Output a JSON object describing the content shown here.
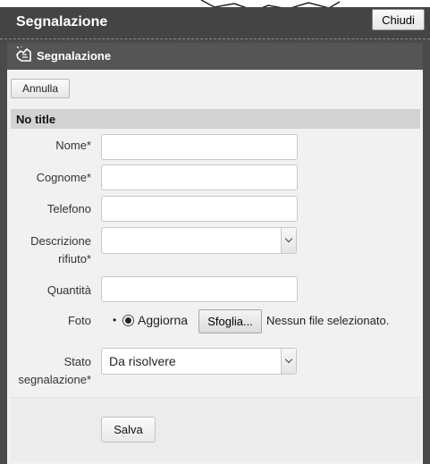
{
  "window": {
    "title": "Segnalazione",
    "close_label": "Chiudi"
  },
  "subheader": {
    "title": "Segnalazione",
    "icon": "report-hand-icon"
  },
  "toolbar": {
    "cancel_label": "Annulla"
  },
  "form": {
    "section_title": "No title",
    "fields": {
      "nome": {
        "label": "Nome*",
        "value": ""
      },
      "cognome": {
        "label": "Cognome*",
        "value": ""
      },
      "telefono": {
        "label": "Telefono",
        "value": ""
      },
      "descrizione": {
        "label_line1": "Descrizione",
        "label_line2": "rifiuto*",
        "value": ""
      },
      "quantita": {
        "label": "Quantità",
        "value": ""
      },
      "foto": {
        "label": "Foto",
        "bullet": "•",
        "radio_label": "Aggiorna",
        "browse_label": "Sfoglia...",
        "file_status": "Nessun file selezionato."
      },
      "stato": {
        "label_line1": "Stato",
        "label_line2": "segnalazione*",
        "value": "Da risolvere"
      }
    },
    "save_label": "Salva"
  }
}
